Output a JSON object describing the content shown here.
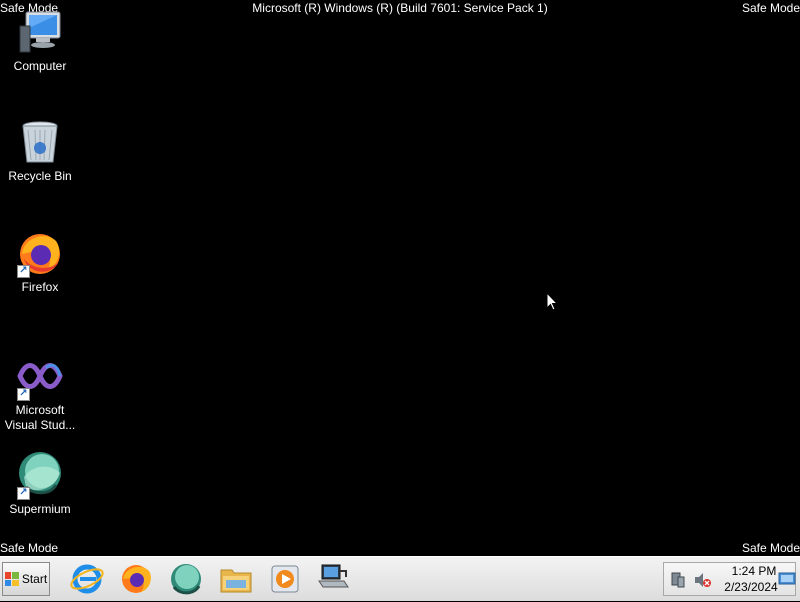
{
  "overlay": {
    "safe_mode": "Safe Mode",
    "build": "Microsoft (R) Windows (R) (Build 7601: Service Pack 1)"
  },
  "desktop_icons": [
    {
      "label": "Computer",
      "icon": "computer-icon"
    },
    {
      "label": "Recycle Bin",
      "icon": "recycle-bin-icon"
    },
    {
      "label": "Firefox",
      "icon": "firefox-icon"
    },
    {
      "label": "Microsoft Visual Stud...",
      "icon": "visual-studio-icon"
    },
    {
      "label": "Supermium",
      "icon": "supermium-icon"
    }
  ],
  "taskbar": {
    "start_label": "Start",
    "pinned": [
      "internet-explorer-icon",
      "firefox-icon",
      "supermium-icon",
      "file-explorer-icon",
      "media-player-icon",
      "remote-desktop-icon"
    ],
    "clock_time": "1:24 PM",
    "clock_date": "2/23/2024"
  },
  "colors": {
    "background": "#000000",
    "taskbar": "#e8e8e8"
  }
}
